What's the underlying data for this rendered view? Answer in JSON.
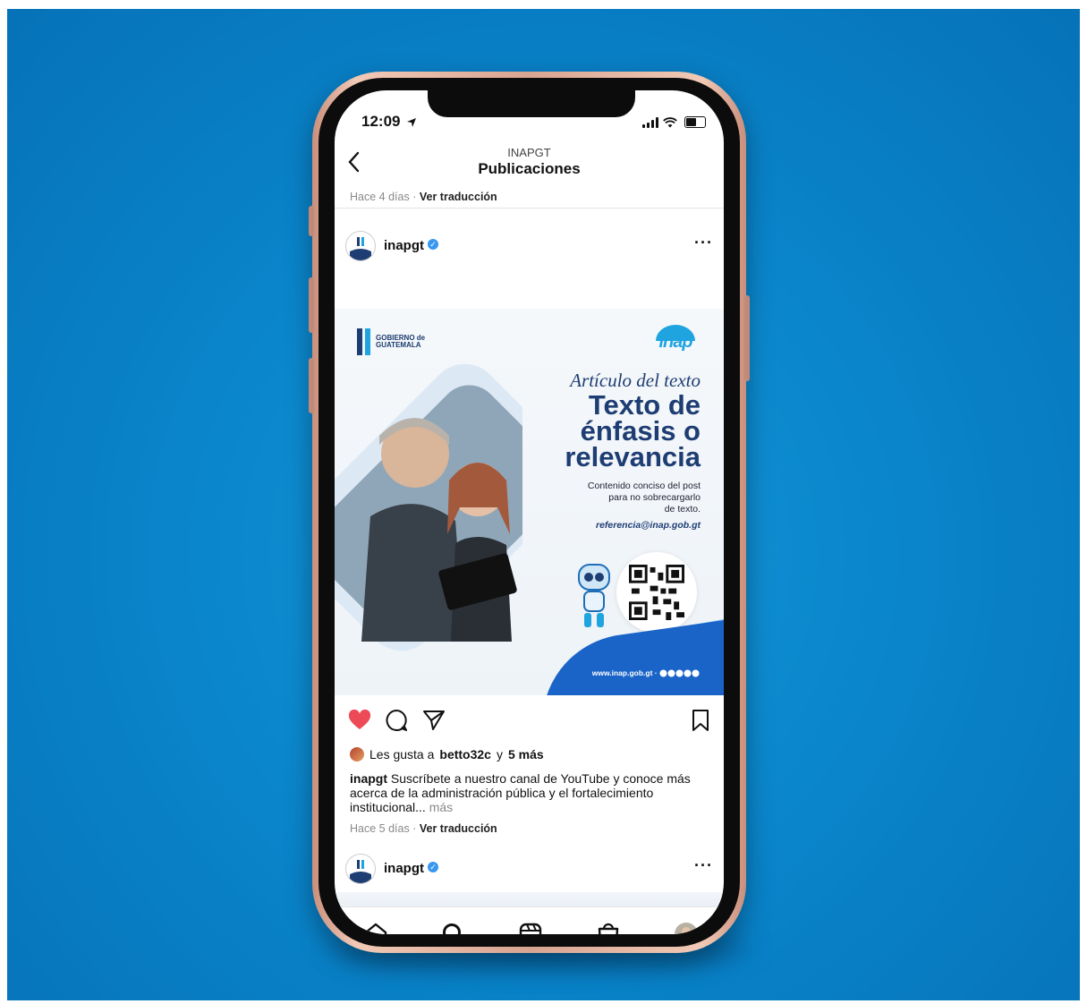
{
  "status_bar": {
    "time": "12:09"
  },
  "header": {
    "account": "INAPGT",
    "title": "Publicaciones"
  },
  "previous_post_meta": {
    "time": "Hace 4 días",
    "separator": "·",
    "translate": "Ver traducción"
  },
  "post": {
    "username": "inapgt",
    "verified_icon": "verified-badge-icon",
    "image": {
      "gov_logo_line1": "GOBIERNO de",
      "gov_logo_line2": "GUATEMALA",
      "brand": "inap",
      "kicker": "Artículo del texto",
      "headline": [
        "Texto de",
        "énfasis o",
        "relevancia"
      ],
      "body": [
        "Contenido conciso del post",
        "para no sobrecargarlo",
        "de texto."
      ],
      "email": "referencia@inap.gob.gt",
      "footer": "www.inap.gob.gt ·"
    },
    "likes": {
      "prefix": "Les gusta a",
      "user": "betto32c",
      "joiner": "y",
      "others": "5 más"
    },
    "caption": {
      "username": "inapgt",
      "text": "Suscríbete a nuestro canal de YouTube y conoce más acerca de la administración pública y el fortalecimiento institucional...",
      "more": "más"
    },
    "meta": {
      "time": "Hace 5 días",
      "separator": "·",
      "translate": "Ver traducción"
    }
  },
  "next_post": {
    "username": "inapgt"
  },
  "colors": {
    "like": "#ed4956",
    "verified": "#3897f0",
    "brand_navy": "#1e3d73",
    "brand_blue": "#1fa4e0"
  },
  "tab_bar": {
    "icons": [
      "home-icon",
      "search-icon",
      "reels-icon",
      "shop-icon",
      "profile-icon"
    ]
  }
}
